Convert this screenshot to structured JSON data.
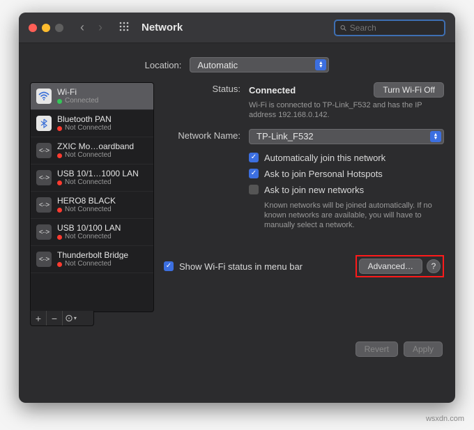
{
  "window": {
    "title": "Network"
  },
  "search": {
    "placeholder": "Search"
  },
  "location": {
    "label": "Location:",
    "value": "Automatic"
  },
  "sidebar": {
    "items": [
      {
        "name": "Wi-Fi",
        "status": "Connected",
        "dot": "green",
        "iconType": "wifi"
      },
      {
        "name": "Bluetooth PAN",
        "status": "Not Connected",
        "dot": "red",
        "iconType": "bt"
      },
      {
        "name": "ZXIC Mo…oardband",
        "status": "Not Connected",
        "dot": "red",
        "iconType": "net"
      },
      {
        "name": "USB 10/1…1000 LAN",
        "status": "Not Connected",
        "dot": "red",
        "iconType": "net"
      },
      {
        "name": "HERO8 BLACK",
        "status": "Not Connected",
        "dot": "red",
        "iconType": "net"
      },
      {
        "name": "USB 10/100 LAN",
        "status": "Not Connected",
        "dot": "red",
        "iconType": "net"
      },
      {
        "name": "Thunderbolt Bridge",
        "status": "Not Connected",
        "dot": "red",
        "iconType": "net"
      }
    ]
  },
  "main": {
    "status_label": "Status:",
    "status_value": "Connected",
    "turn_off_label": "Turn Wi-Fi Off",
    "status_desc": "Wi-Fi is connected to TP-Link_F532 and has the IP address 192.168.0.142.",
    "network_label": "Network Name:",
    "network_value": "TP-Link_F532",
    "auto_join": "Automatically join this network",
    "ask_hotspots": "Ask to join Personal Hotspots",
    "ask_new": "Ask to join new networks",
    "ask_new_desc": "Known networks will be joined automatically. If no known networks are available, you will have to manually select a network.",
    "show_menubar": "Show Wi-Fi status in menu bar",
    "advanced_label": "Advanced…",
    "revert_label": "Revert",
    "apply_label": "Apply"
  },
  "watermark": "wsxdn.com"
}
